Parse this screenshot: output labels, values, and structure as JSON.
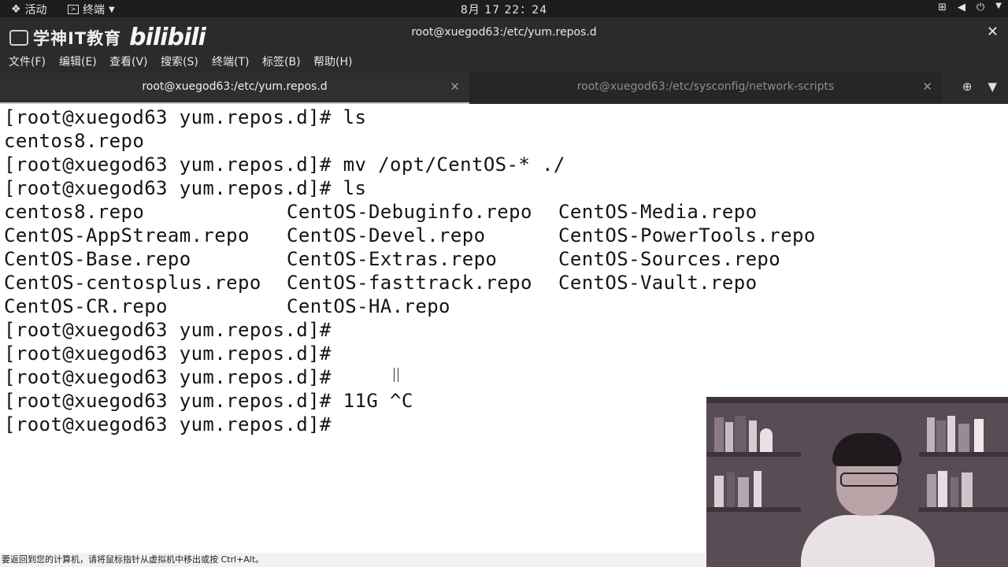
{
  "topbar": {
    "activities": "活动",
    "app_menu": "终端",
    "clock": "8月 17  22：24"
  },
  "window": {
    "title": "root@xuegod63:/etc/yum.repos.d",
    "watermark_cn": "学神IT教育",
    "watermark_bili": "bilibili"
  },
  "menubar": {
    "items": [
      "文件(F)",
      "编辑(E)",
      "查看(V)",
      "搜索(S)",
      "终端(T)",
      "标签(B)",
      "帮助(H)"
    ]
  },
  "tabs": [
    {
      "label": "root@xuegod63:/etc/yum.repos.d",
      "active": true
    },
    {
      "label": "root@xuegod63:/etc/sysconfig/network-scripts",
      "active": false
    }
  ],
  "terminal": {
    "lines": [
      "[root@xuegod63 yum.repos.d]# ls",
      "centos8.repo",
      "[root@xuegod63 yum.repos.d]# mv /opt/CentOS-* ./",
      "[root@xuegod63 yum.repos.d]# ls"
    ],
    "listing": [
      [
        "centos8.repo",
        "CentOS-Debuginfo.repo",
        "CentOS-Media.repo"
      ],
      [
        "CentOS-AppStream.repo",
        "CentOS-Devel.repo",
        "CentOS-PowerTools.repo"
      ],
      [
        "CentOS-Base.repo",
        "CentOS-Extras.repo",
        "CentOS-Sources.repo"
      ],
      [
        "CentOS-centosplus.repo",
        "CentOS-fasttrack.repo",
        "CentOS-Vault.repo"
      ],
      [
        "CentOS-CR.repo",
        "CentOS-HA.repo",
        ""
      ]
    ],
    "after": [
      "[root@xuegod63 yum.repos.d]#",
      "[root@xuegod63 yum.repos.d]#",
      "[root@xuegod63 yum.repos.d]#",
      "[root@xuegod63 yum.repos.d]# 11G ^C",
      "[root@xuegod63 yum.repos.d]#"
    ]
  },
  "statusline": {
    "text": "要返回到您的计算机，请将鼠标指针从虚拟机中移出或按 Ctrl+Alt。"
  }
}
